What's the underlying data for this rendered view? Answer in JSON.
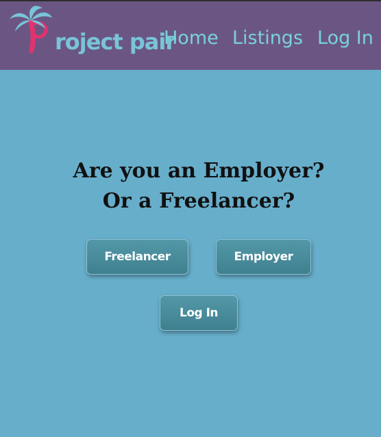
{
  "header": {
    "logo_text": "roject pair",
    "logo_letter": "P",
    "nav": [
      {
        "label": "Home"
      },
      {
        "label": "Listings"
      },
      {
        "label": "Log In"
      }
    ]
  },
  "main": {
    "heading_line1": "Are you an Employer?",
    "heading_line2": "Or a Freelancer?",
    "freelancer_button": "Freelancer",
    "employer_button": "Employer",
    "login_button": "Log In"
  },
  "colors": {
    "background": "#67aecb",
    "header": "#6b5683",
    "nav_text": "#78d3d9",
    "button": "#4a8e9e",
    "logo_pink": "#e2336f",
    "logo_teal": "#79c4d8"
  }
}
